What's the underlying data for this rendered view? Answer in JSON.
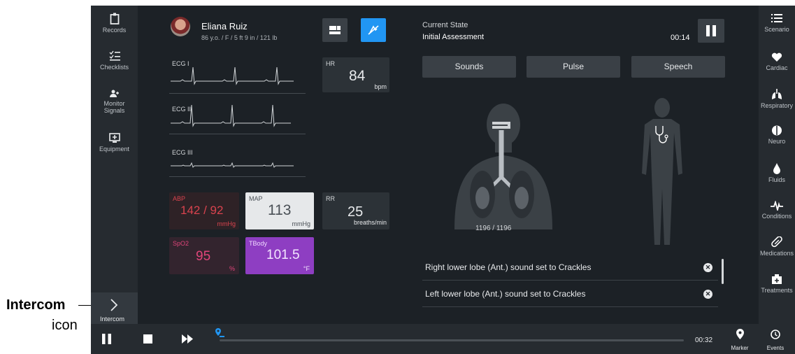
{
  "callout": {
    "title": "Intercom",
    "subtitle": "icon"
  },
  "left_nav": [
    {
      "label": "Records",
      "icon": "clipboard-icon"
    },
    {
      "label": "Checklists",
      "icon": "checklist-icon"
    },
    {
      "label": "Monitor Signals",
      "icon": "monitor-signals-icon"
    },
    {
      "label": "Equipment",
      "icon": "equipment-icon"
    }
  ],
  "intercom": {
    "label": "Intercom",
    "icon": "chevron-right-icon"
  },
  "patient": {
    "name": "Eliana Ruiz",
    "details": "86 y.o. / F / 5 ft 9 in / 121 lb"
  },
  "ecg": [
    "ECG I",
    "ECG II",
    "ECG III"
  ],
  "vitals": {
    "hr": {
      "label": "HR",
      "value": "84",
      "unit": "bpm"
    },
    "abp": {
      "label": "ABP",
      "value": "142 / 92",
      "unit": "mmHg",
      "color": "#d9434e"
    },
    "map": {
      "label": "MAP",
      "value": "113",
      "unit": "mmHg"
    },
    "rr": {
      "label": "RR",
      "value": "25",
      "unit": "breaths/min"
    },
    "spo2": {
      "label": "SpO2",
      "value": "95",
      "unit": "%",
      "color": "#e0457a"
    },
    "tbody": {
      "label": "TBody",
      "value": "101.5",
      "unit": "°F",
      "color": "#8e3ec2"
    }
  },
  "state": {
    "label": "Current State",
    "name": "Initial Assessment",
    "timer": "00:14"
  },
  "tabs": [
    "Sounds",
    "Pulse",
    "Speech"
  ],
  "counter": "1196 / 1196",
  "messages": [
    "Right lower lobe (Ant.) sound set to Crackles",
    "Left lower lobe (Ant.) sound set to Crackles"
  ],
  "right_nav": [
    {
      "label": "Scenario",
      "icon": "list-icon"
    },
    {
      "label": "Cardiac",
      "icon": "heart-icon"
    },
    {
      "label": "Respiratory",
      "icon": "lungs-icon"
    },
    {
      "label": "Neuro",
      "icon": "brain-icon"
    },
    {
      "label": "Fluids",
      "icon": "drop-icon"
    },
    {
      "label": "Conditions",
      "icon": "pulse-wave-icon"
    },
    {
      "label": "Medications",
      "icon": "pill-icon"
    },
    {
      "label": "Treatments",
      "icon": "treatment-icon"
    }
  ],
  "bottom": {
    "time": "00:32",
    "progress": 0.0,
    "marker_label": "Marker",
    "events_label": "Events"
  },
  "colors": {
    "accent": "#2196f3",
    "background": "#1c2126",
    "panel": "#2c3237"
  }
}
